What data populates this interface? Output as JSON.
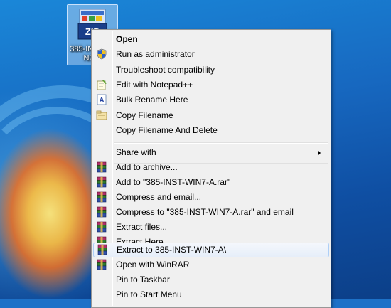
{
  "desktop": {
    "icon": {
      "label": "385-INST-WIN7-A",
      "image_text": "ZIP"
    }
  },
  "context_menu": {
    "items": [
      {
        "label": "Open",
        "icon": "none",
        "bold": true
      },
      {
        "label": "Run as administrator",
        "icon": "uac-shield-icon"
      },
      {
        "label": "Troubleshoot compatibility",
        "icon": "none"
      },
      {
        "label": "Edit with Notepad++",
        "icon": "notepad-plus-icon"
      },
      {
        "label": "Bulk Rename Here",
        "icon": "bulk-rename-icon"
      },
      {
        "label": "Copy Filename",
        "icon": "copy-filename-icon"
      },
      {
        "label": "Copy Filename And Delete",
        "icon": "none"
      },
      {
        "label": "Share with",
        "icon": "none",
        "submenu": true
      },
      {
        "label": "Add to archive...",
        "icon": "winrar-icon"
      },
      {
        "label": "Add to \"385-INST-WIN7-A.rar\"",
        "icon": "winrar-icon"
      },
      {
        "label": "Compress and email...",
        "icon": "winrar-icon"
      },
      {
        "label": "Compress to \"385-INST-WIN7-A.rar\" and email",
        "icon": "winrar-icon"
      },
      {
        "label": "Extract files...",
        "icon": "winrar-icon"
      },
      {
        "label": "Extract Here",
        "icon": "winrar-icon"
      },
      {
        "label": "Extract to 385-INST-WIN7-A\\",
        "icon": "winrar-icon",
        "highlighted": true
      },
      {
        "label": "Open with WinRAR",
        "icon": "winrar-icon"
      },
      {
        "label": "Pin to Taskbar",
        "icon": "none"
      },
      {
        "label": "Pin to Start Menu",
        "icon": "none"
      }
    ]
  },
  "colors": {
    "menu_background": "#f0f0f0",
    "highlight_border": "#aecff7",
    "desktop_blue": "#1768c0"
  }
}
